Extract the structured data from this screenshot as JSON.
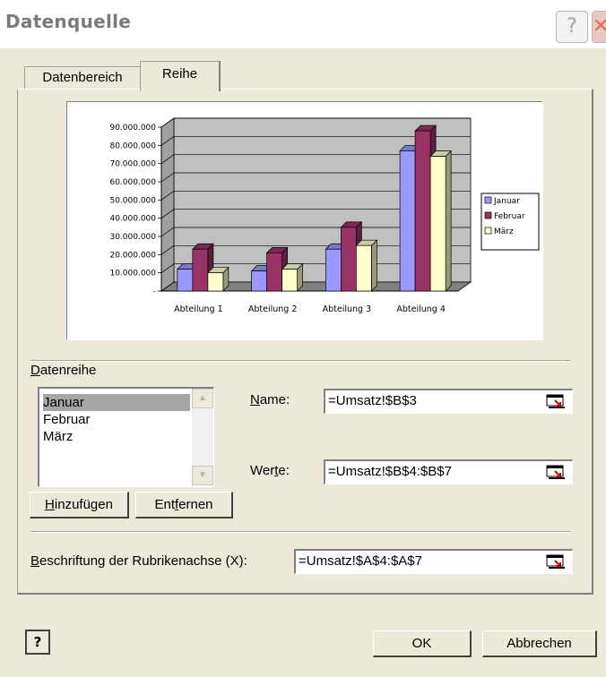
{
  "window": {
    "title": "Datenquelle",
    "help_btn": "?",
    "close_btn": "✕"
  },
  "tabs": [
    {
      "label": "Datenbereich"
    },
    {
      "label": "Reihe"
    }
  ],
  "chart_data": {
    "type": "bar",
    "categories": [
      "Abteilung 1",
      "Abteilung 2",
      "Abteilung 3",
      "Abteilung 4"
    ],
    "series": [
      {
        "name": "Januar",
        "values": [
          12000000,
          11000000,
          23000000,
          77000000
        ],
        "color": "#9999ff"
      },
      {
        "name": "Februar",
        "values": [
          23000000,
          21000000,
          35000000,
          88000000
        ],
        "color": "#993366"
      },
      {
        "name": "März",
        "values": [
          10000000,
          12000000,
          25000000,
          74000000
        ],
        "color": "#ffffcc"
      }
    ],
    "ylim": [
      0,
      90000000
    ],
    "yticks": [
      "90.000.000",
      "80.000.000",
      "70.000.000",
      "60.000.000",
      "50.000.000",
      "40.000.000",
      "30.000.000",
      "20.000.000",
      "10.000.000",
      "-"
    ],
    "legend_position": "right",
    "grid": true
  },
  "datenreihe": {
    "label_pre": "",
    "label_u": "D",
    "label_post": "atenreihe",
    "items": [
      "Januar",
      "Februar",
      "März"
    ],
    "selected": "Januar"
  },
  "name_field": {
    "label_u": "N",
    "label_post": "ame:",
    "value": "=Umsatz!$B$3"
  },
  "werte_field": {
    "label_pre": "Wer",
    "label_u": "t",
    "label_post": "e:",
    "value": "=Umsatz!$B$4:$B$7"
  },
  "buttons": {
    "add_u": "H",
    "add_post": "inzufügen",
    "remove_pre": "Ent",
    "remove_u": "f",
    "remove_post": "ernen",
    "ok": "OK",
    "cancel": "Abbrechen",
    "help": "?"
  },
  "rubrik": {
    "label_u": "B",
    "label_post": "eschriftung der Rubrikenachse (X):",
    "value": "=Umsatz!$A$4:$A$7"
  }
}
